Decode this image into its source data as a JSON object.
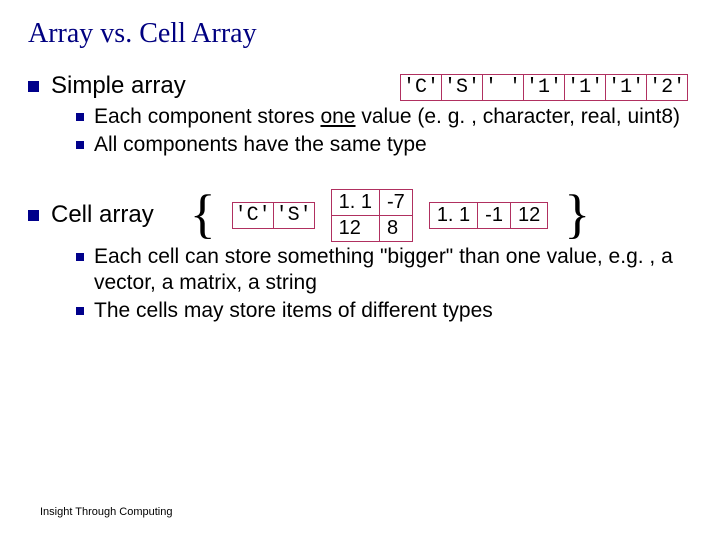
{
  "title": "Array vs. Cell Array",
  "simple": {
    "heading": "Simple array",
    "points": [
      "Each component stores one value (e. g. , character, real, uint8)",
      "All components have the same type"
    ],
    "cells": [
      "'C'",
      "'S'",
      "' '",
      "'1'",
      "'1'",
      "'1'",
      "'2'"
    ]
  },
  "cell": {
    "heading": "Cell array",
    "points": [
      "Each cell can store something \"bigger\" than one value, e.g. , a vector, a matrix, a string",
      "The cells may store items of different types"
    ],
    "item1": [
      "'C'",
      "'S'"
    ],
    "item2": [
      [
        "1. 1",
        "-7"
      ],
      [
        "12",
        "8"
      ]
    ],
    "item3": [
      "1. 1",
      "-1",
      "12"
    ]
  },
  "footer": "Insight Through Computing"
}
